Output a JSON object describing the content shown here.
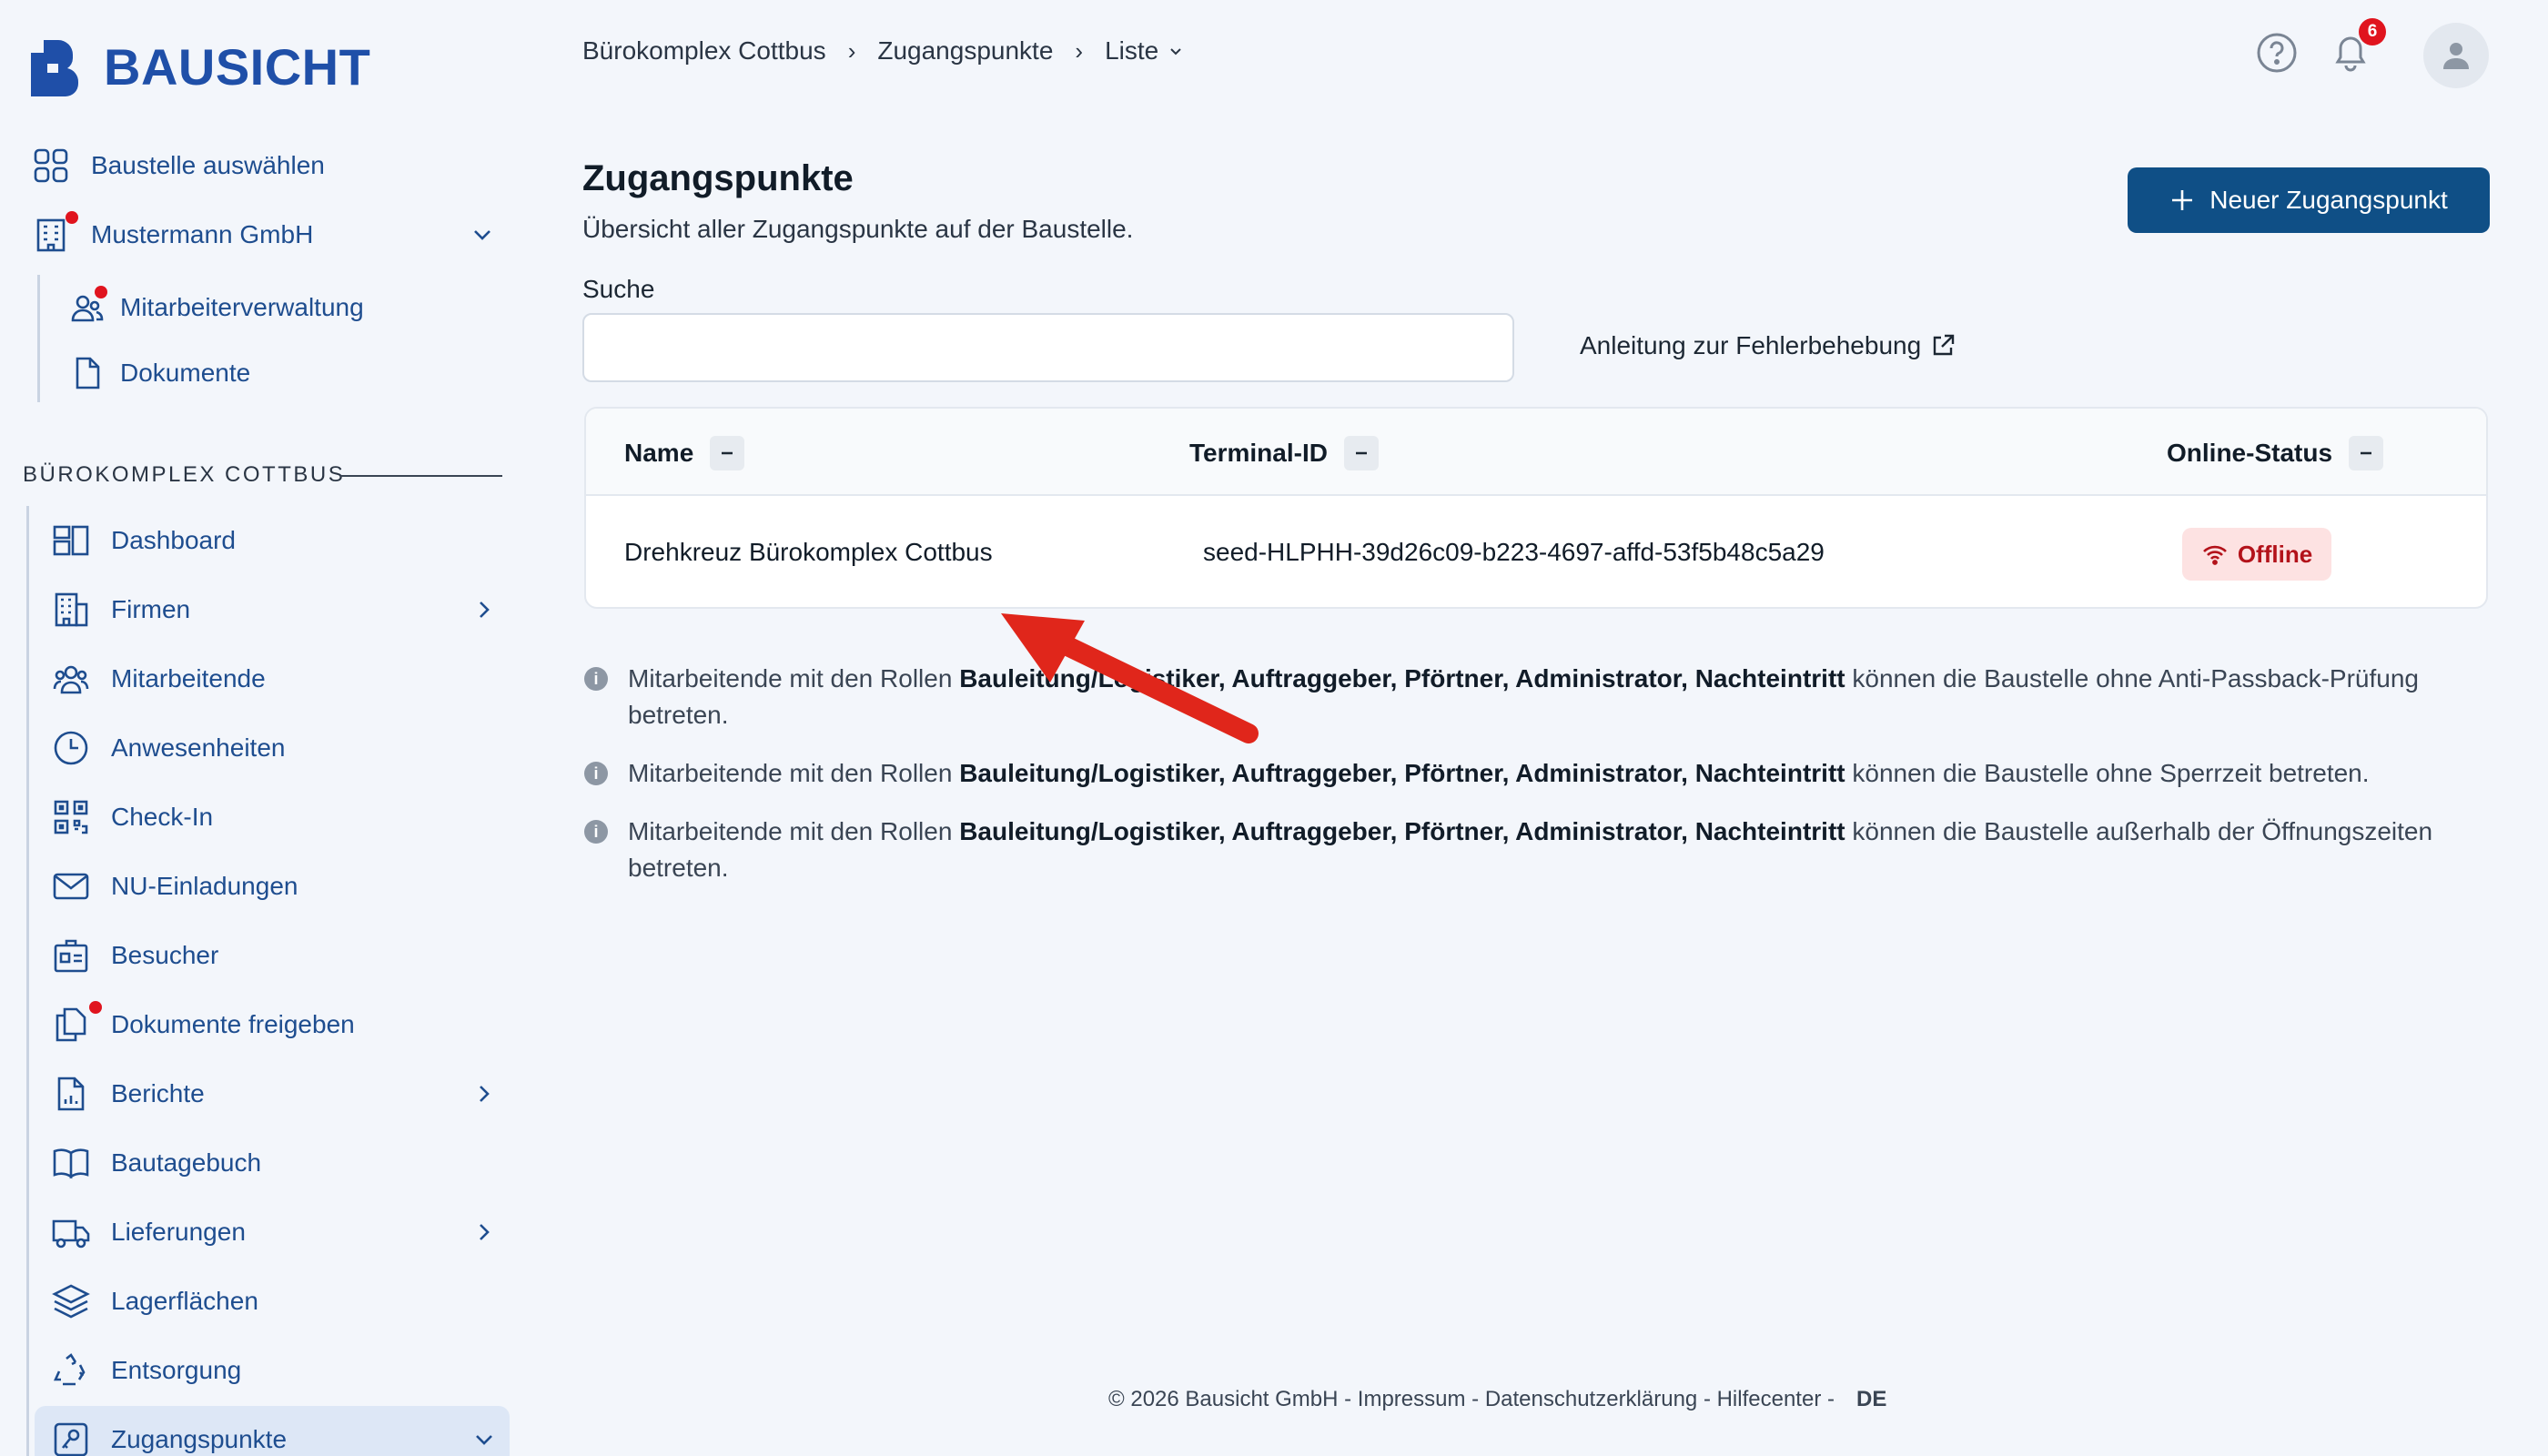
{
  "brand": {
    "name": "BAUSICHT"
  },
  "sidebar": {
    "top_items": [
      {
        "label": "Baustelle auswählen",
        "icon": "grid-icon"
      },
      {
        "label": "Mustermann GmbH",
        "icon": "building-icon",
        "has_dot": true,
        "expanded": true
      }
    ],
    "company_sub_items": [
      {
        "label": "Mitarbeiterverwaltung",
        "icon": "users-icon",
        "has_dot": true
      },
      {
        "label": "Dokumente",
        "icon": "document-icon"
      }
    ],
    "section_title": "BÜROKOMPLEX COTTBUS",
    "nav_items": [
      {
        "label": "Dashboard",
        "icon": "dashboard-icon"
      },
      {
        "label": "Firmen",
        "icon": "office-building-icon",
        "chevron": "right"
      },
      {
        "label": "Mitarbeitende",
        "icon": "people-group-icon"
      },
      {
        "label": "Anwesenheiten",
        "icon": "clock-icon"
      },
      {
        "label": "Check-In",
        "icon": "qr-code-icon"
      },
      {
        "label": "NU-Einladungen",
        "icon": "mail-icon"
      },
      {
        "label": "Besucher",
        "icon": "id-badge-icon"
      },
      {
        "label": "Dokumente freigeben",
        "icon": "documents-copy-icon",
        "has_dot": true
      },
      {
        "label": "Berichte",
        "icon": "report-icon",
        "chevron": "right"
      },
      {
        "label": "Bautagebuch",
        "icon": "book-icon"
      },
      {
        "label": "Lieferungen",
        "icon": "truck-icon",
        "chevron": "right"
      },
      {
        "label": "Lagerflächen",
        "icon": "layers-icon"
      },
      {
        "label": "Entsorgung",
        "icon": "recycle-icon"
      },
      {
        "label": "Zugangspunkte",
        "icon": "key-icon",
        "chevron": "down",
        "active": true
      }
    ]
  },
  "breadcrumb": {
    "items": [
      "Bürokomplex Cottbus",
      "Zugangspunkte",
      "Liste"
    ]
  },
  "header": {
    "notification_count": "6"
  },
  "main": {
    "title": "Zugangspunkte",
    "subtitle": "Übersicht aller Zugangspunkte auf der Baustelle.",
    "new_button_label": "Neuer Zugangspunkt",
    "search_label": "Suche",
    "search_value": "",
    "help_link_label": "Anleitung zur Fehlerbehebung",
    "table": {
      "columns": [
        "Name",
        "Terminal-ID",
        "Online-Status"
      ],
      "rows": [
        {
          "name": "Drehkreuz Bürokomplex Cottbus",
          "terminal_id": "seed-HLPHH-39d26c09-b223-4697-affd-53f5b48c5a29",
          "status": "Offline"
        }
      ]
    },
    "notes": [
      {
        "prefix": "Mitarbeitende mit den Rollen ",
        "roles": "Bauleitung/Logistiker, Auftraggeber, Pförtner, Administrator, Nachteintritt",
        "suffix": " können die Baustelle ohne Anti-Passback-Prüfung betreten."
      },
      {
        "prefix": "Mitarbeitende mit den Rollen ",
        "roles": "Bauleitung/Logistiker, Auftraggeber, Pförtner, Administrator, Nachteintritt",
        "suffix": " können die Baustelle ohne Sperrzeit betreten."
      },
      {
        "prefix": "Mitarbeitende mit den Rollen ",
        "roles": "Bauleitung/Logistiker, Auftraggeber, Pförtner, Administrator, Nachteintritt",
        "suffix": " können die Baustelle außerhalb der Öffnungszeiten betreten."
      }
    ]
  },
  "footer": {
    "text": "© 2026 Bausicht GmbH - Impressum - Datenschutzerklärung - Hilfecenter -",
    "language": "DE"
  },
  "colors": {
    "brand_blue": "#1f4fa8",
    "nav_text": "#1e4d8f",
    "primary_button": "#0f4f86",
    "offline_bg": "#fde2e2",
    "offline_text": "#b3121a",
    "notification_red": "#e0141e",
    "annotation_arrow": "#e0261b"
  }
}
